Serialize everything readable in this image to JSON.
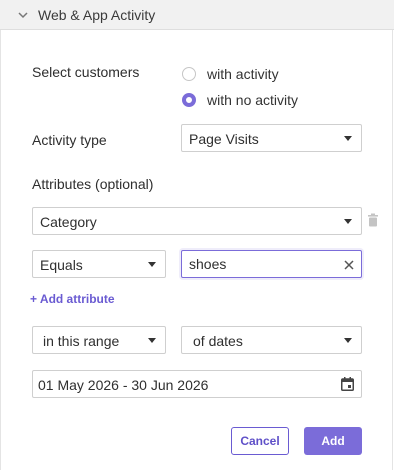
{
  "panel": {
    "title": "Web & App Activity",
    "collapse_icon": "chevron-down-icon"
  },
  "customers": {
    "label": "Select customers",
    "options": [
      {
        "label": "with activity",
        "selected": false
      },
      {
        "label": "with no activity",
        "selected": true
      }
    ]
  },
  "activity_type": {
    "label": "Activity type",
    "value": "Page Visits"
  },
  "attributes": {
    "label": "Attributes (optional)",
    "attribute_value": "Category",
    "operator_value": "Equals",
    "filter_value": "shoes",
    "add_label": "+ Add attribute",
    "remove_icon": "trash-icon",
    "clear_icon": "close-icon"
  },
  "range": {
    "range_value": "in this range",
    "unit_value": "of dates",
    "date_range": "01 May 2026 - 30 Jun 2026",
    "calendar_icon": "calendar-icon"
  },
  "actions": {
    "cancel_label": "Cancel",
    "add_label": "Add"
  },
  "colors": {
    "accent": "#7b6cd9",
    "accent_text": "#6a5bd2",
    "header_bg": "#f1f1f1",
    "border": "#cfcfcf"
  }
}
